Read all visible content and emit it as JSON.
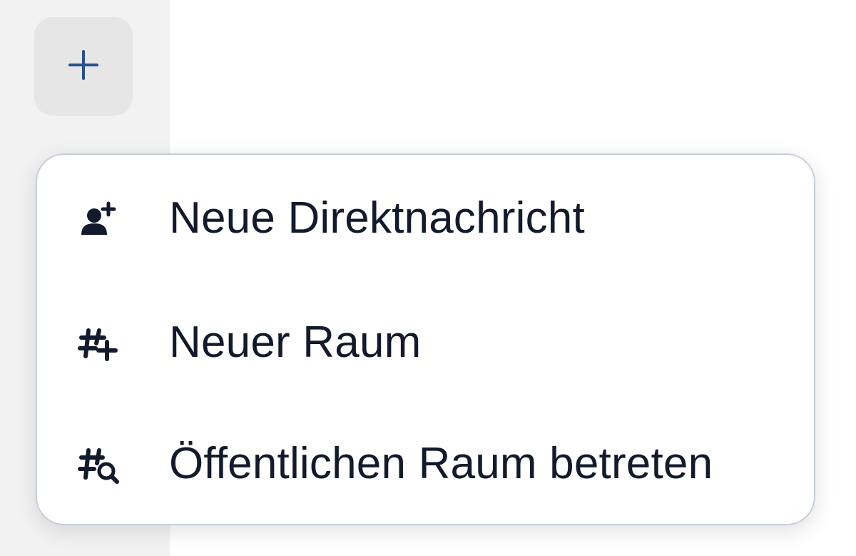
{
  "rail": {
    "add_button": {
      "icon": "plus-icon",
      "accent": "#2b4f8a"
    }
  },
  "menu": {
    "items": [
      {
        "label": "Neue Direktnachricht",
        "icon": "user-add-icon"
      },
      {
        "label": "Neuer Raum",
        "icon": "room-add-icon"
      },
      {
        "label": "Öffentlichen Raum betreten",
        "icon": "room-search-icon"
      }
    ]
  },
  "colors": {
    "text": "#121a2c",
    "menu_border": "#c6cfd9",
    "rail_bg": "#f2f2f2",
    "button_bg": "#e6e6e6"
  }
}
